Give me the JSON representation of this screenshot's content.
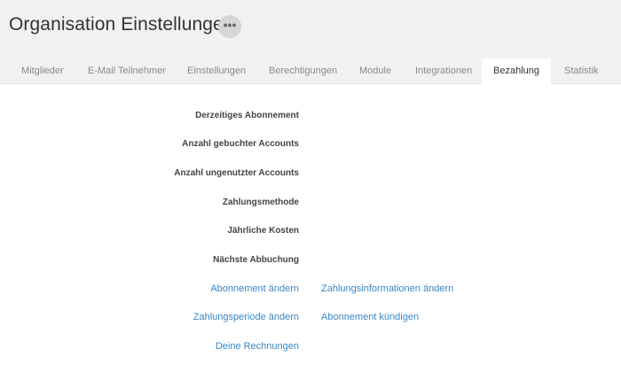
{
  "header": {
    "title": "Organisation Einstellungen",
    "more_label": "•••"
  },
  "tabs": [
    {
      "label": "Mitglieder",
      "active": false
    },
    {
      "label": "E-Mail Teilnehmer",
      "active": false
    },
    {
      "label": "Einstellungen",
      "active": false
    },
    {
      "label": "Berechtigungen",
      "active": false
    },
    {
      "label": "Module",
      "active": false
    },
    {
      "label": "Integrationen",
      "active": false
    },
    {
      "label": "Bezahlung",
      "active": true
    },
    {
      "label": "Statistik",
      "active": false
    }
  ],
  "details": {
    "rows": [
      {
        "label": "Derzeitiges Abonnement",
        "value": ""
      },
      {
        "label": "Anzahl gebuchter Accounts",
        "value": ""
      },
      {
        "label": "Anzahl ungenutzter Accounts",
        "value": ""
      },
      {
        "label": "Zahlungsmethode",
        "value": ""
      },
      {
        "label": "Jährliche Kosten",
        "value": ""
      },
      {
        "label": "Nächste Abbuchung",
        "value": ""
      }
    ]
  },
  "actions": {
    "change_subscription": "Abonnement ändern",
    "change_payment_info": "Zahlungsinformationen ändern",
    "change_payment_period": "Zahlungsperiode ändern",
    "cancel_subscription": "Abonnement kündigen",
    "invoices": "Deine Rechnungen"
  },
  "colors": {
    "link": "#3a86c8",
    "header_bg": "#f1f1f1"
  }
}
